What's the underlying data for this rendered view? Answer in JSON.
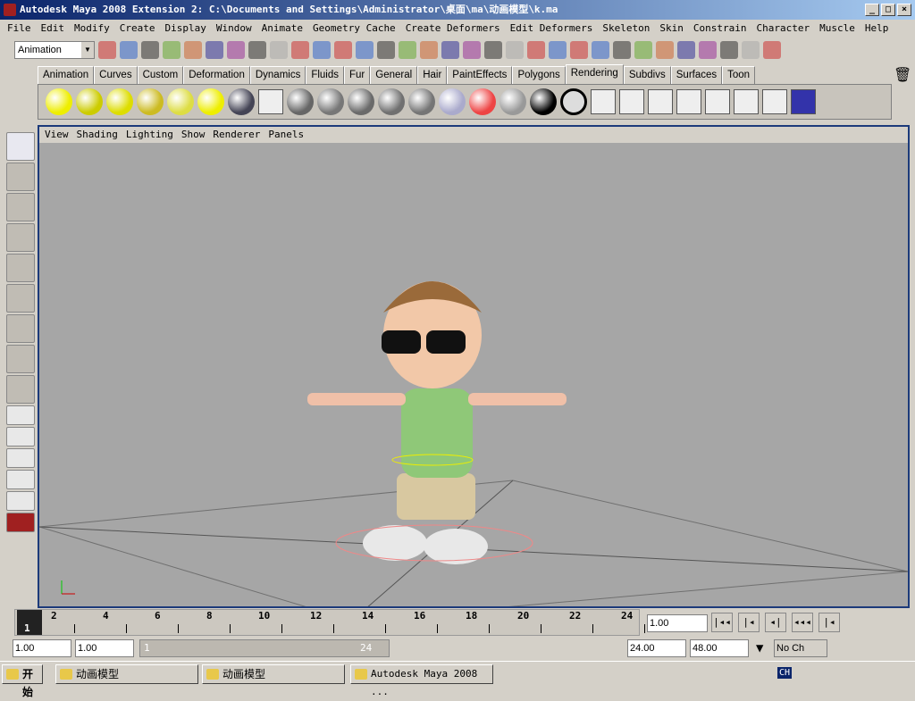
{
  "window": {
    "title": "Autodesk Maya 2008 Extension 2: C:\\Documents and Settings\\Administrator\\桌面\\ma\\动画模型\\k.ma",
    "min": "_",
    "max": "□",
    "close": "×"
  },
  "menu": [
    "File",
    "Edit",
    "Modify",
    "Create",
    "Display",
    "Window",
    "Animate",
    "Geometry Cache",
    "Create Deformers",
    "Edit Deformers",
    "Skeleton",
    "Skin",
    "Constrain",
    "Character",
    "Muscle",
    "Help"
  ],
  "mode": "Animation",
  "shelf_tabs": [
    "Animation",
    "Curves",
    "Custom",
    "Deformation",
    "Dynamics",
    "Fluids",
    "Fur",
    "General",
    "Hair",
    "PaintEffects",
    "Polygons",
    "Rendering",
    "Subdivs",
    "Surfaces",
    "Toon"
  ],
  "active_tab": "Rendering",
  "viewport": {
    "menu": [
      "View",
      "Shading",
      "Lighting",
      "Show",
      "Renderer",
      "Panels"
    ],
    "camera": "persp"
  },
  "timeline": {
    "ticks": [
      "2",
      "4",
      "6",
      "8",
      "10",
      "12",
      "14",
      "16",
      "18",
      "20",
      "22",
      "24"
    ],
    "current_frame": "1",
    "current_time": "1.00"
  },
  "range": {
    "start": "1.00",
    "playback_start": "1.00",
    "slider_start": "1",
    "slider_end": "24",
    "playback_end": "24.00",
    "end": "48.00",
    "character": "No Ch"
  },
  "playback_buttons": [
    "go-to-start",
    "step-back",
    "play-back-key",
    "step-back-frame",
    "play-back"
  ],
  "taskbar": {
    "start": "开始",
    "items": [
      "动画模型",
      "动画模型",
      "Autodesk Maya 2008 ..."
    ],
    "tray": "CH"
  },
  "colors": {
    "title": "#0a246a",
    "viewport_bg": "#a6a6a6",
    "viewport_border": "#1c3a7a"
  }
}
